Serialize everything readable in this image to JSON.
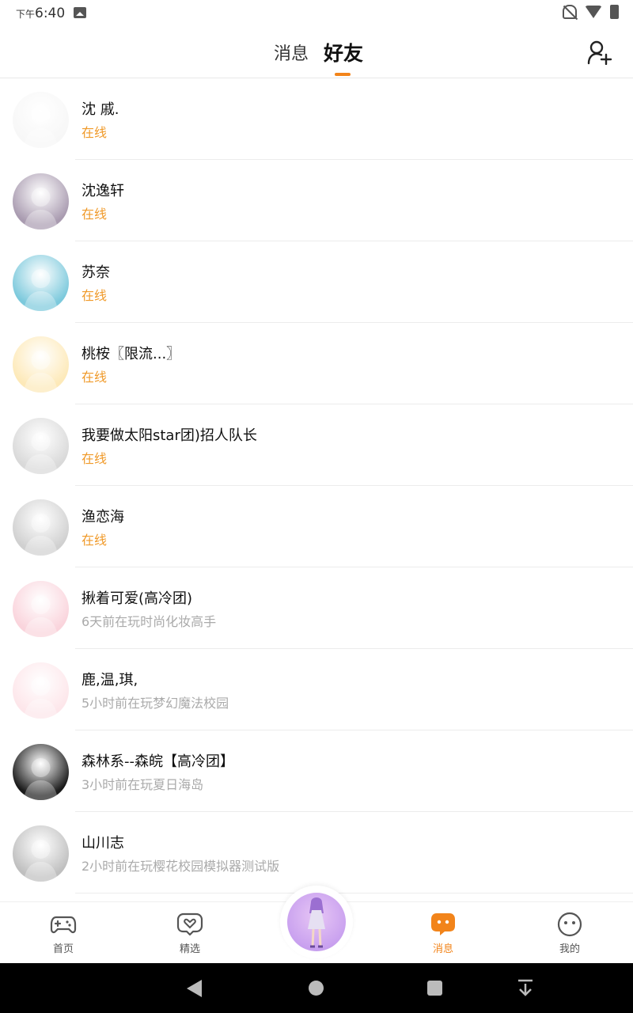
{
  "status_bar": {
    "time_prefix": "下午",
    "time": "6:40"
  },
  "header": {
    "tabs": [
      {
        "label": "消息",
        "active": false
      },
      {
        "label": "好友",
        "active": true
      }
    ],
    "add_friend_icon": "add-user-icon"
  },
  "colors": {
    "accent": "#f2841a",
    "online": "#f09a2a",
    "offline_text": "#aaaaaa"
  },
  "friends": [
    {
      "name": "沈 戚.",
      "status": "在线",
      "online": true,
      "avatar_bg": "#f7f7f7"
    },
    {
      "name": "沈逸轩",
      "status": "在线",
      "online": true,
      "avatar_bg": "#a99bb0"
    },
    {
      "name": "苏奈",
      "status": "在线",
      "online": true,
      "avatar_bg": "#7cc9dc"
    },
    {
      "name": "桃桉〖限流...〗",
      "status": "在线",
      "online": true,
      "avatar_bg": "#fde9b8"
    },
    {
      "name": "我要做太阳star团)招人队长",
      "status": "在线",
      "online": true,
      "avatar_bg": "#d9d9d9"
    },
    {
      "name": "渔恋海",
      "status": "在线",
      "online": true,
      "avatar_bg": "#d0d0d0"
    },
    {
      "name": "揪着可爱(高冷团)",
      "status": "6天前在玩时尚化妆高手",
      "online": false,
      "avatar_bg": "#fad4dc"
    },
    {
      "name": "鹿,温,琪,",
      "status": "5小时前在玩梦幻魔法校园",
      "online": false,
      "avatar_bg": "#fde6ea"
    },
    {
      "name": "森林系--森皖【高冷团】",
      "status": "3小时前在玩夏日海岛",
      "online": false,
      "avatar_bg": "#1a1a1a"
    },
    {
      "name": "山川志",
      "status": "2小时前在玩樱花校园模拟器测试版",
      "online": false,
      "avatar_bg": "#bfbfbf"
    }
  ],
  "bottom_nav": [
    {
      "label": "首页",
      "icon": "gamepad-icon",
      "active": false
    },
    {
      "label": "精选",
      "icon": "heart-chat-icon",
      "active": false
    },
    {
      "label": "消息",
      "icon": "message-icon",
      "active": true
    },
    {
      "label": "我的",
      "icon": "smiley-icon",
      "active": false
    }
  ]
}
